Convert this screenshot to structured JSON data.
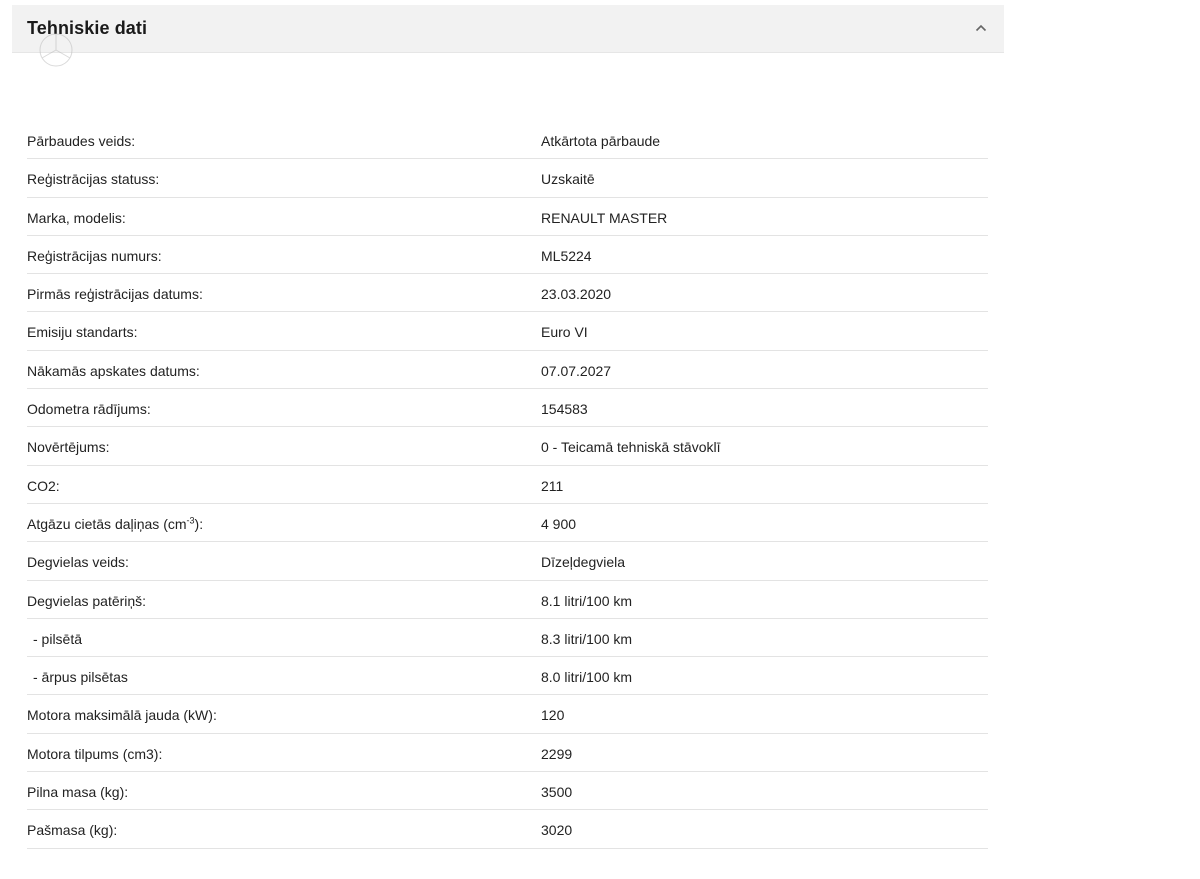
{
  "section": {
    "title": "Tehniskie dati",
    "collapse_icon": "chevron-up-icon",
    "watermark_icon": "logo-watermark-icon"
  },
  "rows": [
    {
      "label": "Pārbaudes veids:",
      "value": "Atkārtota pārbaude"
    },
    {
      "label": "Reģistrācijas statuss:",
      "value": "Uzskaitē"
    },
    {
      "label": "Marka, modelis:",
      "value": "RENAULT MASTER"
    },
    {
      "label": "Reģistrācijas numurs:",
      "value": "ML5224"
    },
    {
      "label": "Pirmās reģistrācijas datums:",
      "value": "23.03.2020"
    },
    {
      "label": "Emisiju standarts:",
      "value": "Euro VI"
    },
    {
      "label": "Nākamās apskates datums:",
      "value": "07.07.2027"
    },
    {
      "label": "Odometra rādījums:",
      "value": "154583"
    },
    {
      "label": "Novērtējums:",
      "value": "0 - Teicamā tehniskā stāvoklī"
    },
    {
      "label": "CO2:",
      "value": "211"
    },
    {
      "label": "Atgāzu cietās daļiņas (cm",
      "label_sup": "-3",
      "label_suffix": "):",
      "value": "4 900"
    },
    {
      "label": "Degvielas veids:",
      "value": "Dīzeļdegviela"
    },
    {
      "label": "Degvielas patēriņš:",
      "value": "8.1 litri/100 km"
    },
    {
      "label": "- pilsētā",
      "value": "8.3 litri/100 km",
      "indent": true
    },
    {
      "label": "- ārpus pilsētas",
      "value": "8.0 litri/100 km",
      "indent": true
    },
    {
      "label": "Motora maksimālā jauda (kW):",
      "value": "120"
    },
    {
      "label": "Motora tilpums (cm3):",
      "value": "2299"
    },
    {
      "label": "Pilna masa (kg):",
      "value": "3500"
    },
    {
      "label": "Pašmasa (kg):",
      "value": "3020"
    }
  ]
}
